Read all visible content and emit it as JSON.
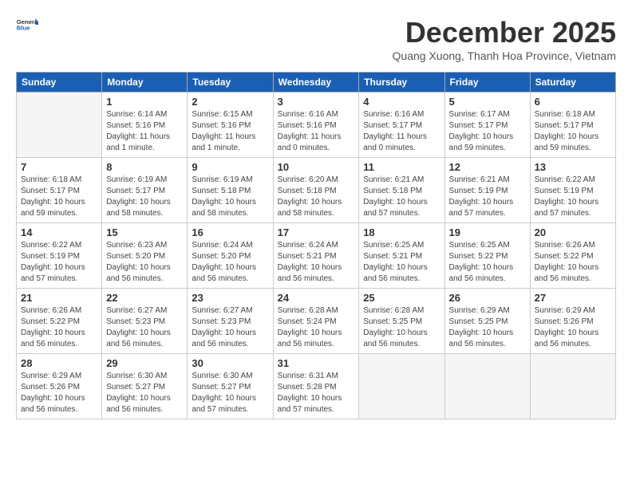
{
  "logo": {
    "text_general": "General",
    "text_blue": "Blue"
  },
  "header": {
    "month_year": "December 2025",
    "subtitle": "Quang Xuong, Thanh Hoa Province, Vietnam"
  },
  "columns": [
    "Sunday",
    "Monday",
    "Tuesday",
    "Wednesday",
    "Thursday",
    "Friday",
    "Saturday"
  ],
  "weeks": [
    [
      {
        "day": "",
        "info": ""
      },
      {
        "day": "1",
        "info": "Sunrise: 6:14 AM\nSunset: 5:16 PM\nDaylight: 11 hours\nand 1 minute."
      },
      {
        "day": "2",
        "info": "Sunrise: 6:15 AM\nSunset: 5:16 PM\nDaylight: 11 hours\nand 1 minute."
      },
      {
        "day": "3",
        "info": "Sunrise: 6:16 AM\nSunset: 5:16 PM\nDaylight: 11 hours\nand 0 minutes."
      },
      {
        "day": "4",
        "info": "Sunrise: 6:16 AM\nSunset: 5:17 PM\nDaylight: 11 hours\nand 0 minutes."
      },
      {
        "day": "5",
        "info": "Sunrise: 6:17 AM\nSunset: 5:17 PM\nDaylight: 10 hours\nand 59 minutes."
      },
      {
        "day": "6",
        "info": "Sunrise: 6:18 AM\nSunset: 5:17 PM\nDaylight: 10 hours\nand 59 minutes."
      }
    ],
    [
      {
        "day": "7",
        "info": "Sunrise: 6:18 AM\nSunset: 5:17 PM\nDaylight: 10 hours\nand 59 minutes."
      },
      {
        "day": "8",
        "info": "Sunrise: 6:19 AM\nSunset: 5:17 PM\nDaylight: 10 hours\nand 58 minutes."
      },
      {
        "day": "9",
        "info": "Sunrise: 6:19 AM\nSunset: 5:18 PM\nDaylight: 10 hours\nand 58 minutes."
      },
      {
        "day": "10",
        "info": "Sunrise: 6:20 AM\nSunset: 5:18 PM\nDaylight: 10 hours\nand 58 minutes."
      },
      {
        "day": "11",
        "info": "Sunrise: 6:21 AM\nSunset: 5:18 PM\nDaylight: 10 hours\nand 57 minutes."
      },
      {
        "day": "12",
        "info": "Sunrise: 6:21 AM\nSunset: 5:19 PM\nDaylight: 10 hours\nand 57 minutes."
      },
      {
        "day": "13",
        "info": "Sunrise: 6:22 AM\nSunset: 5:19 PM\nDaylight: 10 hours\nand 57 minutes."
      }
    ],
    [
      {
        "day": "14",
        "info": "Sunrise: 6:22 AM\nSunset: 5:19 PM\nDaylight: 10 hours\nand 57 minutes."
      },
      {
        "day": "15",
        "info": "Sunrise: 6:23 AM\nSunset: 5:20 PM\nDaylight: 10 hours\nand 56 minutes."
      },
      {
        "day": "16",
        "info": "Sunrise: 6:24 AM\nSunset: 5:20 PM\nDaylight: 10 hours\nand 56 minutes."
      },
      {
        "day": "17",
        "info": "Sunrise: 6:24 AM\nSunset: 5:21 PM\nDaylight: 10 hours\nand 56 minutes."
      },
      {
        "day": "18",
        "info": "Sunrise: 6:25 AM\nSunset: 5:21 PM\nDaylight: 10 hours\nand 56 minutes."
      },
      {
        "day": "19",
        "info": "Sunrise: 6:25 AM\nSunset: 5:22 PM\nDaylight: 10 hours\nand 56 minutes."
      },
      {
        "day": "20",
        "info": "Sunrise: 6:26 AM\nSunset: 5:22 PM\nDaylight: 10 hours\nand 56 minutes."
      }
    ],
    [
      {
        "day": "21",
        "info": "Sunrise: 6:26 AM\nSunset: 5:22 PM\nDaylight: 10 hours\nand 56 minutes."
      },
      {
        "day": "22",
        "info": "Sunrise: 6:27 AM\nSunset: 5:23 PM\nDaylight: 10 hours\nand 56 minutes."
      },
      {
        "day": "23",
        "info": "Sunrise: 6:27 AM\nSunset: 5:23 PM\nDaylight: 10 hours\nand 56 minutes."
      },
      {
        "day": "24",
        "info": "Sunrise: 6:28 AM\nSunset: 5:24 PM\nDaylight: 10 hours\nand 56 minutes."
      },
      {
        "day": "25",
        "info": "Sunrise: 6:28 AM\nSunset: 5:25 PM\nDaylight: 10 hours\nand 56 minutes."
      },
      {
        "day": "26",
        "info": "Sunrise: 6:29 AM\nSunset: 5:25 PM\nDaylight: 10 hours\nand 56 minutes."
      },
      {
        "day": "27",
        "info": "Sunrise: 6:29 AM\nSunset: 5:26 PM\nDaylight: 10 hours\nand 56 minutes."
      }
    ],
    [
      {
        "day": "28",
        "info": "Sunrise: 6:29 AM\nSunset: 5:26 PM\nDaylight: 10 hours\nand 56 minutes."
      },
      {
        "day": "29",
        "info": "Sunrise: 6:30 AM\nSunset: 5:27 PM\nDaylight: 10 hours\nand 56 minutes."
      },
      {
        "day": "30",
        "info": "Sunrise: 6:30 AM\nSunset: 5:27 PM\nDaylight: 10 hours\nand 57 minutes."
      },
      {
        "day": "31",
        "info": "Sunrise: 6:31 AM\nSunset: 5:28 PM\nDaylight: 10 hours\nand 57 minutes."
      },
      {
        "day": "",
        "info": ""
      },
      {
        "day": "",
        "info": ""
      },
      {
        "day": "",
        "info": ""
      }
    ]
  ]
}
